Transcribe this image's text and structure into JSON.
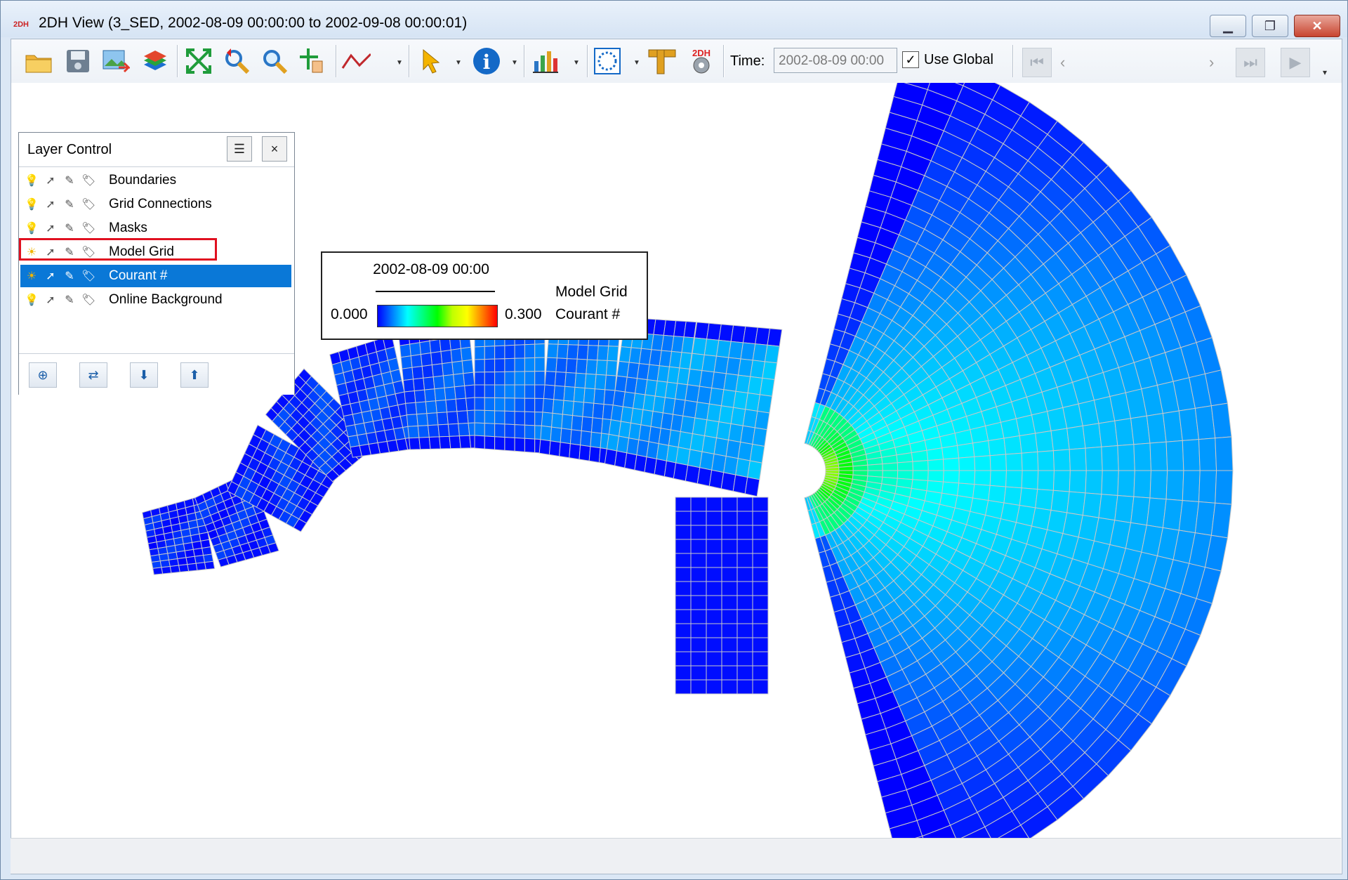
{
  "window": {
    "app_icon_text": "2DH",
    "title": "2DH View (3_SED, 2002-08-09 00:00:00 to 2002-09-08 00:00:01)"
  },
  "toolbar": {
    "time_label": "Time:",
    "time_value": "2002-08-09 00:00",
    "use_global_checked": true,
    "use_global_label": "Use Global",
    "export_icon_text": "2DH"
  },
  "layer_control": {
    "title": "Layer Control",
    "menu_symbol": "☰",
    "close_symbol": "×",
    "layers": [
      {
        "name": "Boundaries",
        "visible": false,
        "selected": false
      },
      {
        "name": "Grid Connections",
        "visible": false,
        "selected": false
      },
      {
        "name": "Masks",
        "visible": false,
        "selected": false
      },
      {
        "name": "Model Grid",
        "visible": true,
        "selected": false
      },
      {
        "name": "Courant #",
        "visible": true,
        "selected": true
      },
      {
        "name": "Online Background",
        "visible": false,
        "selected": false
      }
    ]
  },
  "legend": {
    "time": "2002-08-09 00:00",
    "layer": "Model Grid",
    "min": "0.000",
    "max": "0.300",
    "variable": "Courant #",
    "colors": [
      "#0000ff",
      "#00ffff",
      "#00ff00",
      "#ffff00",
      "#ff0000"
    ]
  },
  "colors": {
    "selection": "#0a78d7",
    "highlight_outline": "#e01020",
    "grid_line": "#c8c8c8"
  }
}
